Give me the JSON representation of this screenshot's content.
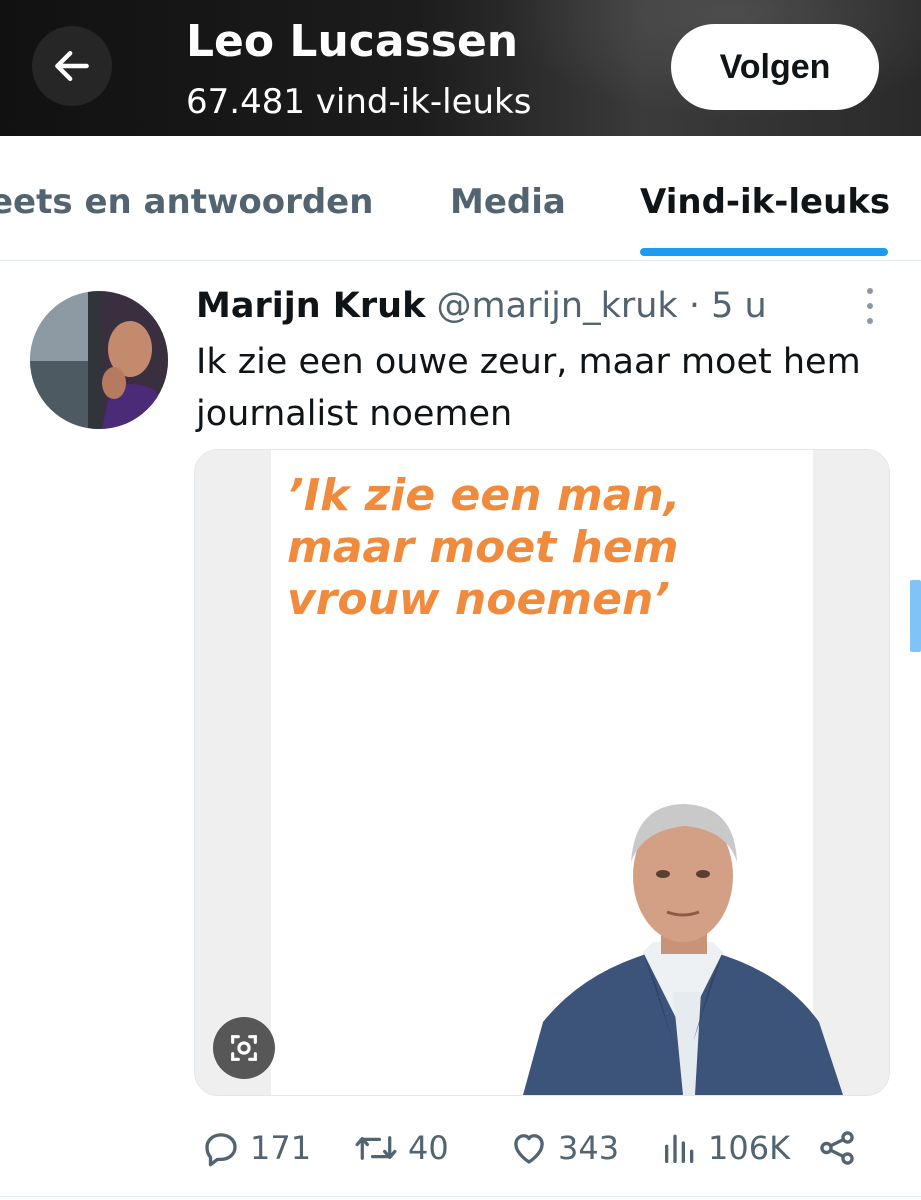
{
  "header": {
    "name": "Leo Lucassen",
    "likes_count": "67.481 vind-ik-leuks",
    "follow_label": "Volgen"
  },
  "tabs": [
    {
      "label": "Tweets en antwoorden",
      "visible_text": "eets en antwoorden",
      "active": false
    },
    {
      "label": "Media",
      "active": false
    },
    {
      "label": "Vind-ik-leuks",
      "active": true
    }
  ],
  "tweet": {
    "author_name": "Marijn Kruk",
    "author_meta": "@marijn_kruk · 5 u",
    "text": "Ik zie een ouwe zeur, maar moet hem journalist noemen",
    "media": {
      "quote_text": "’Ik zie een man,\nmaar moet hem\nvrouw noemen’"
    },
    "actions": {
      "replies": "171",
      "retweets": "40",
      "likes": "343",
      "views": "106K"
    }
  },
  "colors": {
    "accent": "#1d9bf0",
    "muted_text": "#536471",
    "quote_orange": "#f08a3c"
  },
  "icons": [
    "arrow-left-icon",
    "more-vertical-icon",
    "scan-icon",
    "reply-icon",
    "retweet-icon",
    "heart-icon",
    "views-icon",
    "share-icon"
  ]
}
